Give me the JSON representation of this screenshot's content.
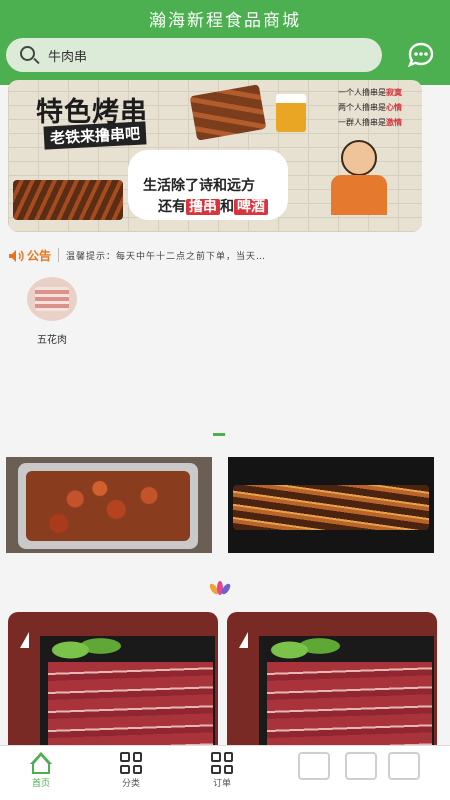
{
  "app": {
    "title": "瀚海新程食品商城"
  },
  "search": {
    "text": "牛肉串"
  },
  "banner": {
    "headline": "特色烤串",
    "subline": "老铁来撸串吧",
    "slogan_line1": "生活除了诗和远方",
    "slogan_line2_pre": "还有",
    "slogan_tag1": "撸串",
    "slogan_mid": "和",
    "slogan_tag2": "啤酒",
    "promo": [
      {
        "pre": "一个人撸串是",
        "tag": "寂寞"
      },
      {
        "pre": "两个人撸串是",
        "tag": "心情"
      },
      {
        "pre": "一群人撸串是",
        "tag": "激情"
      }
    ]
  },
  "notice": {
    "label": "公告",
    "text": "温馨提示：每天中午十二点之前下单，当天…"
  },
  "categories": [
    {
      "label": "五花肉"
    }
  ],
  "tabs": [
    {
      "label": "首页",
      "icon": "home-icon",
      "active": true
    },
    {
      "label": "分类",
      "icon": "grid-icon",
      "active": false
    },
    {
      "label": "订单",
      "icon": "grid-icon",
      "active": false
    }
  ],
  "colors": {
    "brand": "#4caf50",
    "notice": "#e9731c",
    "accent_red": "#d8343b"
  }
}
